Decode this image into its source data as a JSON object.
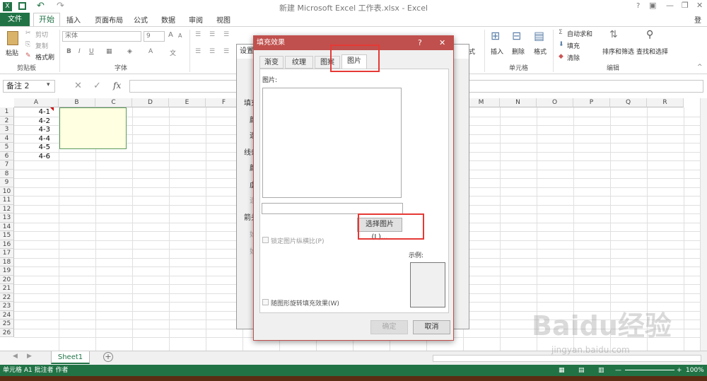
{
  "window": {
    "title": "新建 Microsoft Excel 工作表.xlsx - Excel",
    "help": "?",
    "signin": "登录"
  },
  "tabs": [
    "文件",
    "开始",
    "插入",
    "页面布局",
    "公式",
    "数据",
    "审阅",
    "视图"
  ],
  "ribbon": {
    "clipboard": {
      "paste": "粘贴",
      "cut": "剪切",
      "copy": "复制",
      "painter": "格式刷",
      "group": "剪贴板"
    },
    "font": {
      "name": "宋体",
      "size": "9",
      "bold": "B",
      "italic": "I",
      "underline": "U",
      "group": "字体"
    },
    "cells": {
      "insert": "插入",
      "delete": "删除",
      "format": "格式",
      "group": "单元格"
    },
    "editing": {
      "autosum": "自动求和",
      "fill": "填充",
      "clear": "清除",
      "sort": "排序和筛选",
      "find": "查找和选择",
      "group": "编辑"
    },
    "format_partial": "式"
  },
  "formula_bar": {
    "namebox": "备注 2",
    "fx": "fx"
  },
  "grid": {
    "columns": [
      "A",
      "B",
      "C",
      "D",
      "E",
      "F",
      "G",
      "H",
      "I",
      "J",
      "K",
      "L",
      "M",
      "N",
      "O",
      "P",
      "Q",
      "R"
    ],
    "rows": [
      "1",
      "2",
      "3",
      "4",
      "5",
      "6",
      "7",
      "8",
      "9",
      "10",
      "11",
      "12",
      "13",
      "14",
      "15",
      "16",
      "17",
      "18",
      "19",
      "20",
      "21",
      "22",
      "23",
      "24",
      "25",
      "26"
    ],
    "cells": [
      "4-1",
      "4-2",
      "4-3",
      "4-4",
      "4-5",
      "4-6"
    ]
  },
  "bg_dialog": {
    "title": "设置",
    "labels": [
      "填充",
      "颜",
      "透",
      "线条",
      "颜",
      "虚",
      "透",
      "箭头",
      "始",
      "始"
    ]
  },
  "dialog": {
    "title": "填充效果",
    "help": "?",
    "close": "✕",
    "tabs": [
      "渐变",
      "纹理",
      "图案",
      "图片"
    ],
    "picture_label": "图片:",
    "select_button": "选择图片(L)...",
    "lock_ratio": "锁定图片纵横比(P)",
    "rotate_fill": "随图形旋转填充效果(W)",
    "sample_label": "示例:",
    "ok": "确定",
    "cancel": "取消"
  },
  "sheets": {
    "active": "Sheet1",
    "add": "+"
  },
  "status": {
    "text": "单元格 A1 批注者 作者",
    "zoom": "100%"
  },
  "watermark": "Baidu经验",
  "watermark_url": "jingyan.baidu.com",
  "colors": {
    "excel_green": "#217346",
    "dialog_red": "#c0504d",
    "highlight": "#e53935",
    "comment_bg": "#ffffe1"
  }
}
